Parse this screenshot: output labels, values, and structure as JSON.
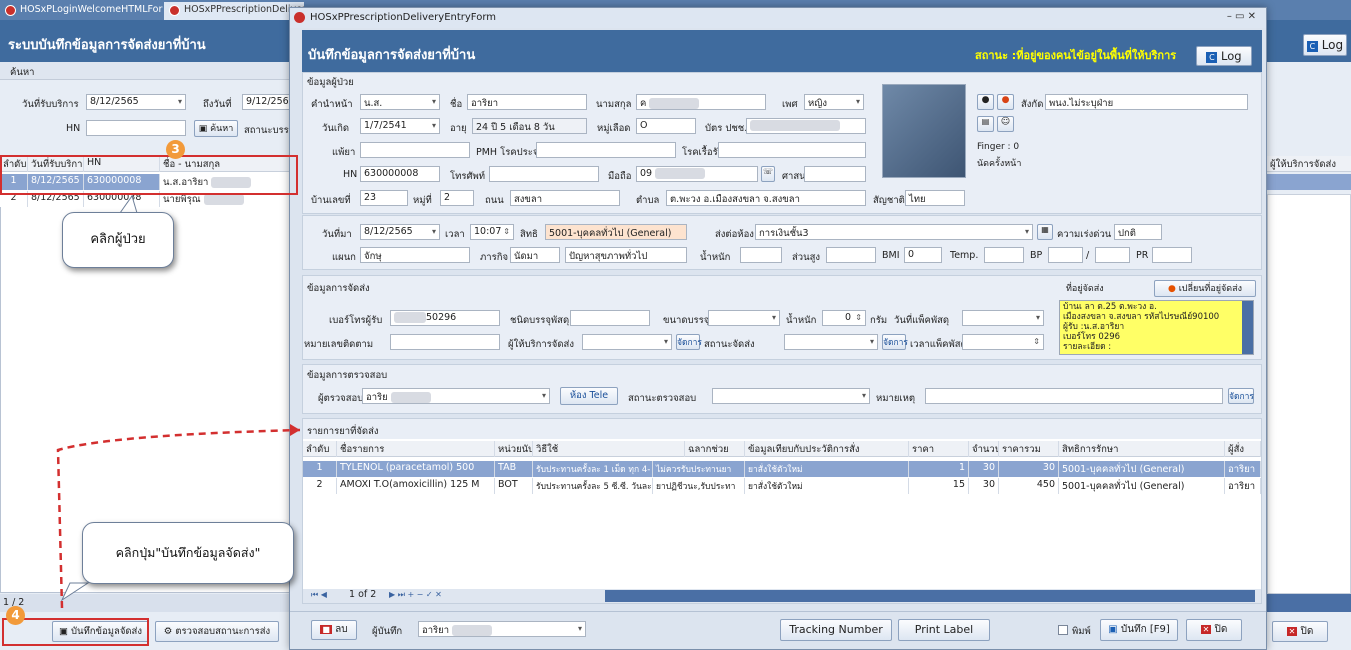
{
  "tabs": [
    {
      "label": "HOSxPLoginWelcomeHTMLForm"
    },
    {
      "label": "HOSxPPrescriptionDelivery"
    }
  ],
  "back": {
    "title": "ระบบบันทึกข้อมูลการจัดส่งยาที่บ้าน",
    "log_label": "Log",
    "search_label": "ค้นหา",
    "date_from_label": "วันที่รับบริการ",
    "date_from": "8/12/2565",
    "date_to_label": "ถึงวันที่",
    "date_to": "9/12/2565",
    "hn_label": "HN",
    "search_button": "ค้นหา",
    "status_label": "สถานะบรรจ",
    "columns": [
      "ลำดับ",
      "วันที่รับบริการ",
      "HN",
      "ชื่อ - นามสกุล"
    ],
    "rows": [
      [
        "1",
        "8/12/2565",
        "630000008",
        "น.ส.อาริยา"
      ],
      [
        "2",
        "8/12/2565",
        "630000038",
        "นายพิรุณ"
      ]
    ],
    "right_col": "ผู้ให้บริการจัดส่ง",
    "pager": "1 / 2",
    "save_button": "บันทึกข้อมูลจัดส่ง",
    "check_button": "ตรวจสอบสถานะการส่ง",
    "close_button": "ปิด"
  },
  "dialog": {
    "window_title": "HOSxPPrescriptionDeliveryEntryForm",
    "heading": "บันทึกข้อมูลการจัดส่งยาที่บ้าน",
    "status_text": "สถานะ :ที่อยู่ของคนไข้อยู่ในพื้นที่ให้บริการ",
    "log_label": "Log",
    "win_controls": "–  ▭  ✕",
    "patient": {
      "section": "ข้อมูลผู้ป่วย",
      "prefix_label": "คำนำหน้า",
      "prefix": "น.ส.",
      "name_label": "ชื่อ",
      "name": "อาริยา",
      "surname_label": "นามสกุล",
      "surname": "ค",
      "sex_label": "เพศ",
      "sex": "หญิง",
      "dob_label": "วันเกิด",
      "dob": "1/7/2541",
      "age_label": "อายุ",
      "age": "24 ปี 5 เดือน 8 วัน",
      "blood_label": "หมู่เลือด",
      "blood": "O",
      "cid_label": "บัตร ปชช.",
      "allergy_label": "แพ้ยา",
      "pmh_label": "PMH โรคประจำตัว",
      "chronic_label": "โรคเรื้อรัง",
      "hn_label": "HN",
      "hn": "630000008",
      "phone_label": "โทรศัพท์",
      "mobile_label": "มือถือ",
      "mobile": "09",
      "religion_label": "ศาสนา",
      "house_label": "บ้านเลขที่",
      "house": "23",
      "moo_label": "หมู่ที่",
      "moo": "2",
      "road_label": "ถนน",
      "road": "สงขลา",
      "tambon_label": "ตำบล",
      "tambon": "ต.พะวง อ.เมืองสงขลา จ.สงขลา",
      "nation_label": "สัญชาติ",
      "nation": "ไทย",
      "dept_label": "สังกัด",
      "dept": "พนง.ไม่ระบุฝ่าย",
      "finger": "Finger : 0",
      "appt": "นัดครั้งหน้า"
    },
    "visit": {
      "date_label": "วันที่มา",
      "date": "8/12/2565",
      "time_label": "เวลา",
      "time": "10:07",
      "right_label": "สิทธิ",
      "right": "5001-บุคคลทั่วไป (General)",
      "send_label": "ส่งต่อห้อง",
      "send": "การเงินชั้น3",
      "urgency_label": "ความเร่งด่วน",
      "urgency": "ปกติ",
      "dept_label": "แผนก",
      "dept": "จักษุ",
      "kind_label": "ภารกิจ",
      "kind": "นัดมา",
      "cc": "ปัญหาสุขภาพทั่วไป",
      "weight_label": "น้ำหนัก",
      "height_label": "ส่วนสูง",
      "bmi_label": "BMI",
      "bmi": "0",
      "temp_label": "Temp.",
      "bp_label": "BP",
      "bp_sep": "/",
      "pr_label": "PR"
    },
    "delivery": {
      "section": "ข้อมูลการจัดส่ง",
      "address_label": "ที่อยู่จัดส่ง",
      "change_address": "เปลี่ยนที่อยู่จัดส่ง",
      "phone_label": "เบอร์โทรผู้รับ",
      "phone": "50296",
      "pkg_type_label": "ชนิดบรรจุพัสดุ",
      "pkg_size_label": "ขนาดบรรจุ",
      "weight_label": "น้ำหนัก",
      "weight": "0",
      "gram": "กรัม",
      "pack_date_label": "วันที่แพ็คพัสดุ",
      "tracking_label": "หมายเลขติดตาม",
      "provider_label": "ผู้ให้บริการจัดส่ง",
      "status_label": "สถานะจัดส่ง",
      "pack_time_label": "เวลาแพ็คพัสดุ",
      "manage": "จัดการ",
      "address_lines": [
        "บ้านเ                    ลา ต.25 ต.พะวง อ.",
        "เมืองสงขลา จ.สงขลา รหัสไปรษณีย์90100",
        "ผู้รับ :น.ส.อาริยา",
        "เบอร์โทร              0296",
        "รายละเอียด :"
      ]
    },
    "verify": {
      "section": "ข้อมูลการตรวจสอบ",
      "checker_label": "ผู้ตรวจสอบ",
      "checker": "อาริย",
      "room_button": "ห้อง Tele",
      "status_label": "สถานะตรวจสอบ",
      "note_label": "หมายเหตุ",
      "manage": "จัดการ"
    },
    "drugs": {
      "section": "รายการยาที่จัดส่ง",
      "columns": [
        "ลำดับ",
        "ชื่อรายการ",
        "หน่วยนับ",
        "วิธีใช้",
        "ฉลากช่วย",
        "ข้อมูลเทียบกับประวัติการสั่ง",
        "ราคา",
        "จำนวน",
        "ราคารวม",
        "สิทธิการรักษา",
        "ผู้สั่ง"
      ],
      "rows": [
        [
          "1",
          "TYLENOL (paracetamol) 500",
          "TAB",
          "รับประทานครั้งละ 1 เม็ด ทุก 4-",
          "ไม่ควรรับประทานยา",
          "ยาสั่งใช้ตัวใหม่",
          "1",
          "30",
          "30",
          "5001-บุคคลทั่วไป (General)",
          "อาริยา"
        ],
        [
          "2",
          "AMOXI T.O(amoxicillin) 125 M",
          "BOT",
          "รับประทานครั้งละ 5 ซี.ซี. วันละ",
          "ยาปฏิชีวนะ,รับประทา",
          "ยาสั่งใช้ตัวใหม่",
          "15",
          "30",
          "450",
          "5001-บุคคลทั่วไป (General)",
          "อาริยา"
        ]
      ],
      "pager": "1 of 2"
    },
    "footer": {
      "delete": "ลบ",
      "recorder_label": "ผู้บันทึก",
      "recorder": "อาริยา",
      "tracking_button": "Tracking Number",
      "print_button": "Print Label",
      "print_check": "พิมพ์",
      "save_button": "บันทึก [F9]",
      "close_button": "ปิด"
    }
  },
  "callouts": {
    "click_patient": "คลิกผู้ป่วย",
    "click_save": "คลิกปุ่ม\"บันทึกข้อมูลจัดส่ง\"",
    "step3": "3",
    "step4": "4"
  },
  "colors": {
    "header_blue": "#3f6b9e",
    "selected_row": "#8aa4d0",
    "status_yellow": "#ffff00",
    "address_bg": "#ffff66",
    "callout_border": "#d32f2f",
    "marker": "#f29a3a"
  }
}
